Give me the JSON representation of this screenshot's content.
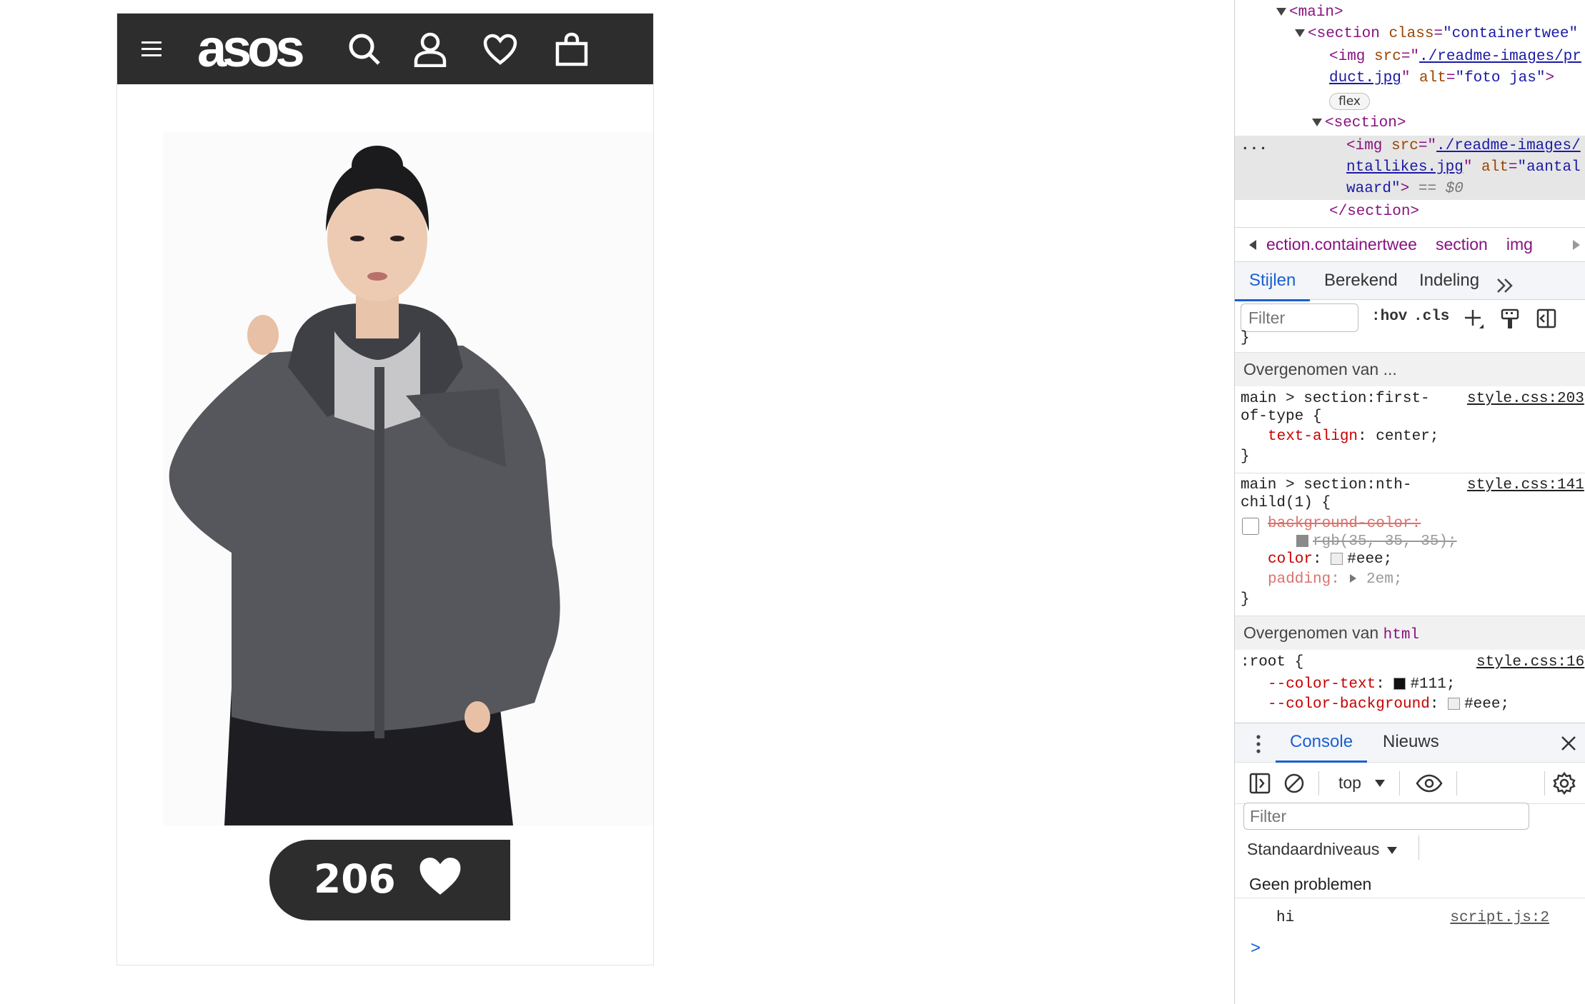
{
  "site": {
    "logo": "asos",
    "icons": [
      "menu-icon",
      "search-icon",
      "account-icon",
      "heart-icon",
      "bag-icon"
    ],
    "likes_count": "206"
  },
  "devtools": {
    "dom": {
      "main_tag": "<main>",
      "section_open": "<section",
      "section_class_attr": "class",
      "section_class_val": "\"containertwee\"",
      "img1_src_attr": "src",
      "img1_src_a": "./readme-images/pr",
      "img1_src_b": "duct.jpg",
      "img1_alt_attr": "alt",
      "img1_alt_val": "\"foto jas\"",
      "flex_badge": "flex",
      "inner_section": "<section>",
      "img2_src_a": "./readme-images/",
      "img2_src_b": "ntallikes.jpg",
      "img2_alt_attr": "alt",
      "img2_alt_val_a": "\"aantal",
      "img2_alt_val_b": "waard\"",
      "selected_marker": "== $0",
      "section_close": "</section>",
      "ellipsis": "..."
    },
    "breadcrumbs": [
      "ection.containertwee",
      "section",
      "img"
    ],
    "tabs": [
      "Stijlen",
      "Berekend",
      "Indeling"
    ],
    "styles_toolbar": {
      "filter_placeholder": "Filter",
      "hov": ":hov",
      "cls": ".cls"
    },
    "inherited_1": "Overgenomen van ...",
    "rule1": {
      "selector_a": "main > section:first-",
      "selector_b": "of-type {",
      "source": "style.css:203",
      "prop": "text-align",
      "value": "center;",
      "close": "}"
    },
    "rule2": {
      "selector_a": "main > section:nth-",
      "selector_b": "child(1) {",
      "source": "style.css:141",
      "prop1": "background-color:",
      "prop1_value": "rgb(35, 35, 35);",
      "prop2": "color",
      "prop2_value": "#eee;",
      "prop3": "padding",
      "prop3_value": "2em;",
      "close": "}"
    },
    "inherited_2_label": "Overgenomen van",
    "inherited_2_tag": "html",
    "rule3": {
      "selector": ":root {",
      "source": "style.css:16",
      "prop1": "--color-text",
      "prop1_value": "#111;",
      "prop2": "--color-background",
      "prop2_value": "#eee;"
    },
    "colors": {
      "swatch_bg": "#232323",
      "swatch_color": "#eeeeee",
      "swatch_text": "#111111",
      "accent": "#1a5fd1"
    },
    "drawer_tabs": [
      "Console",
      "Nieuws"
    ],
    "console": {
      "context": "top",
      "filter_placeholder": "Filter",
      "levels": "Standaardniveaus",
      "no_issues": "Geen problemen",
      "log_message": "hi",
      "log_source": "script.js:2",
      "prompt": ">"
    }
  }
}
